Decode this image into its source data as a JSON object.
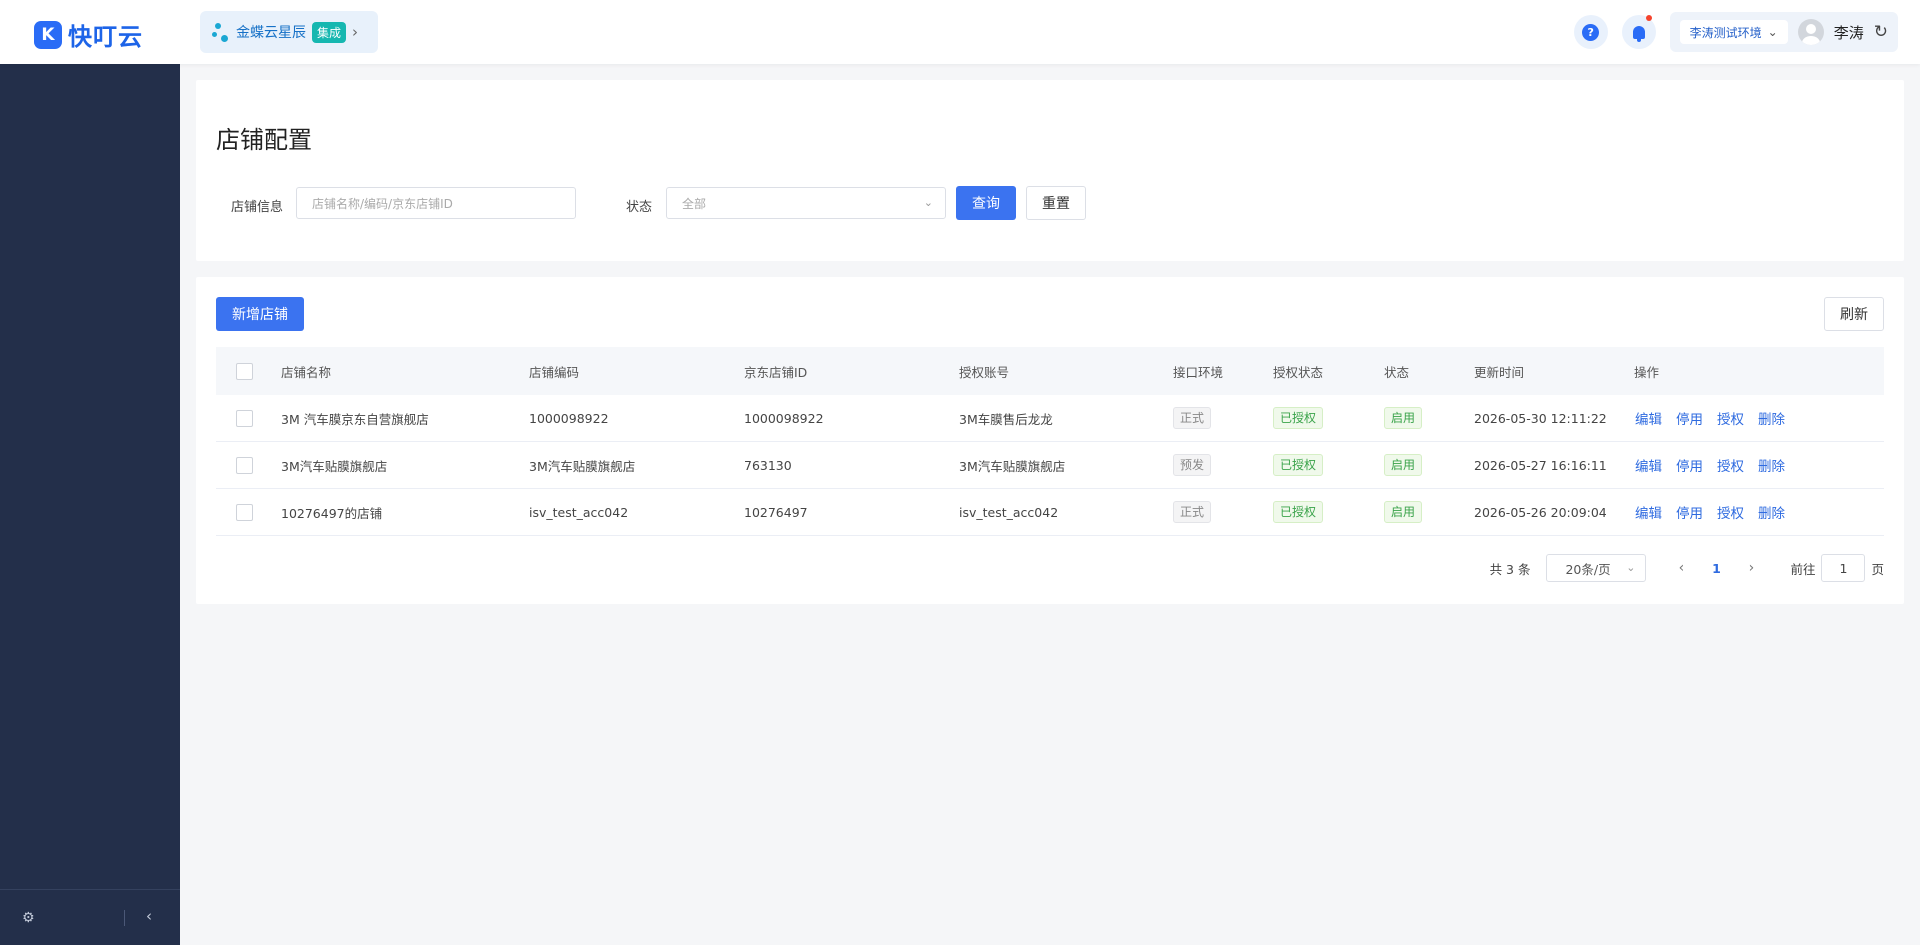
{
  "app": {
    "logo_mark": "K",
    "logo_text": "快叮云"
  },
  "product": {
    "name": "金蝶云星辰",
    "badge": "集成"
  },
  "header": {
    "help": "?",
    "environment": "李涛测试环境",
    "user_name": "李涛"
  },
  "page": {
    "title": "店铺配置"
  },
  "filter": {
    "shop_info_label": "店铺信息",
    "shop_info_placeholder": "店铺名称/编码/京东店铺ID",
    "status_label": "状态",
    "status_value": "全部",
    "query_label": "查询",
    "reset_label": "重置"
  },
  "toolbar": {
    "add_label": "新增店铺",
    "refresh_label": "刷新"
  },
  "table": {
    "columns": [
      "店铺名称",
      "店铺编码",
      "京东店铺ID",
      "授权账号",
      "接口环境",
      "授权状态",
      "状态",
      "更新时间",
      "操作"
    ],
    "actions": [
      "编辑",
      "停用",
      "授权",
      "删除"
    ],
    "rows": [
      {
        "name": "3M 汽车膜京东自营旗舰店",
        "code": "1000098922",
        "jd_id": "1000098922",
        "account": "3M车膜售后龙龙",
        "env": "正式",
        "auth": "已授权",
        "status": "启用",
        "updated": "2026-05-30 12:11:22"
      },
      {
        "name": "3M汽车贴膜旗舰店",
        "code": "3M汽车贴膜旗舰店",
        "jd_id": "763130",
        "account": "3M汽车贴膜旗舰店",
        "env": "预发",
        "auth": "已授权",
        "status": "启用",
        "updated": "2026-05-27 16:16:11"
      },
      {
        "name": "10276497的店铺",
        "code": "isv_test_acc042",
        "jd_id": "10276497",
        "account": "isv_test_acc042",
        "env": "正式",
        "auth": "已授权",
        "status": "启用",
        "updated": "2026-05-26 20:09:04"
      }
    ]
  },
  "pagination": {
    "total_text": "共 3 条",
    "page_size": "20条/页",
    "current_page": "1",
    "goto_label": "前往",
    "goto_value": "1",
    "page_unit": "页"
  },
  "colors": {
    "primary": "#3b73f0",
    "sidebar": "#232f4a",
    "success": "#3aa34a"
  }
}
